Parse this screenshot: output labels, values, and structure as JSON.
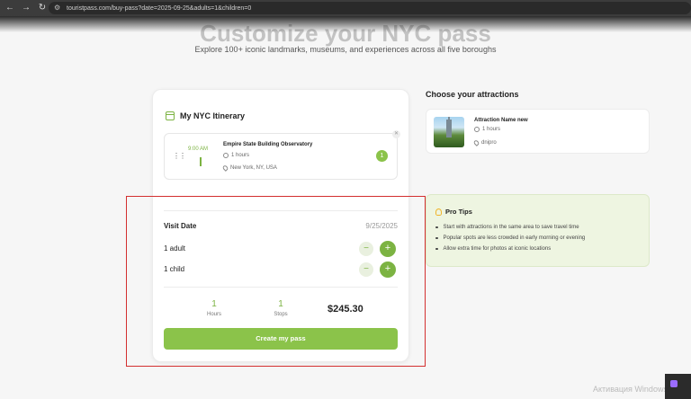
{
  "browser": {
    "url": "touristpass.com/buy-pass?date=2025-09-25&adults=1&children=0"
  },
  "hero": {
    "title": "Customize your NYC pass",
    "subtitle": "Explore 100+ iconic landmarks, museums, and experiences across all five boroughs"
  },
  "itinerary": {
    "title": "My NYC Itinerary",
    "items": [
      {
        "time": "9:00 AM",
        "name": "Empire State Building Observatory",
        "duration": "1 hours",
        "location": "New York, NY, USA",
        "order": "1"
      }
    ]
  },
  "booking": {
    "visit_date_label": "Visit Date",
    "visit_date_value": "9/25/2025",
    "adults_label": "1 adult",
    "children_label": "1 child",
    "minus_symbol": "−",
    "plus_symbol": "+",
    "hours_value": "1",
    "hours_label": "Hours",
    "stops_value": "1",
    "stops_label": "Stops",
    "price": "$245.30",
    "create_button": "Create my pass"
  },
  "attractions": {
    "title": "Choose your attractions",
    "items": [
      {
        "name": "Attraction Name new",
        "duration": "1 hours",
        "location": "dnipro"
      }
    ]
  },
  "tips": {
    "title": "Pro Tips",
    "items": [
      "Start with attractions in the same area to save travel time",
      "Popular spots are less crowded in early morning or evening",
      "Allow extra time for photos at iconic locations"
    ]
  },
  "system": {
    "watermark": "Активация Windows"
  },
  "colors": {
    "accent": "#8bc34a",
    "highlight": "#d32f2f"
  }
}
